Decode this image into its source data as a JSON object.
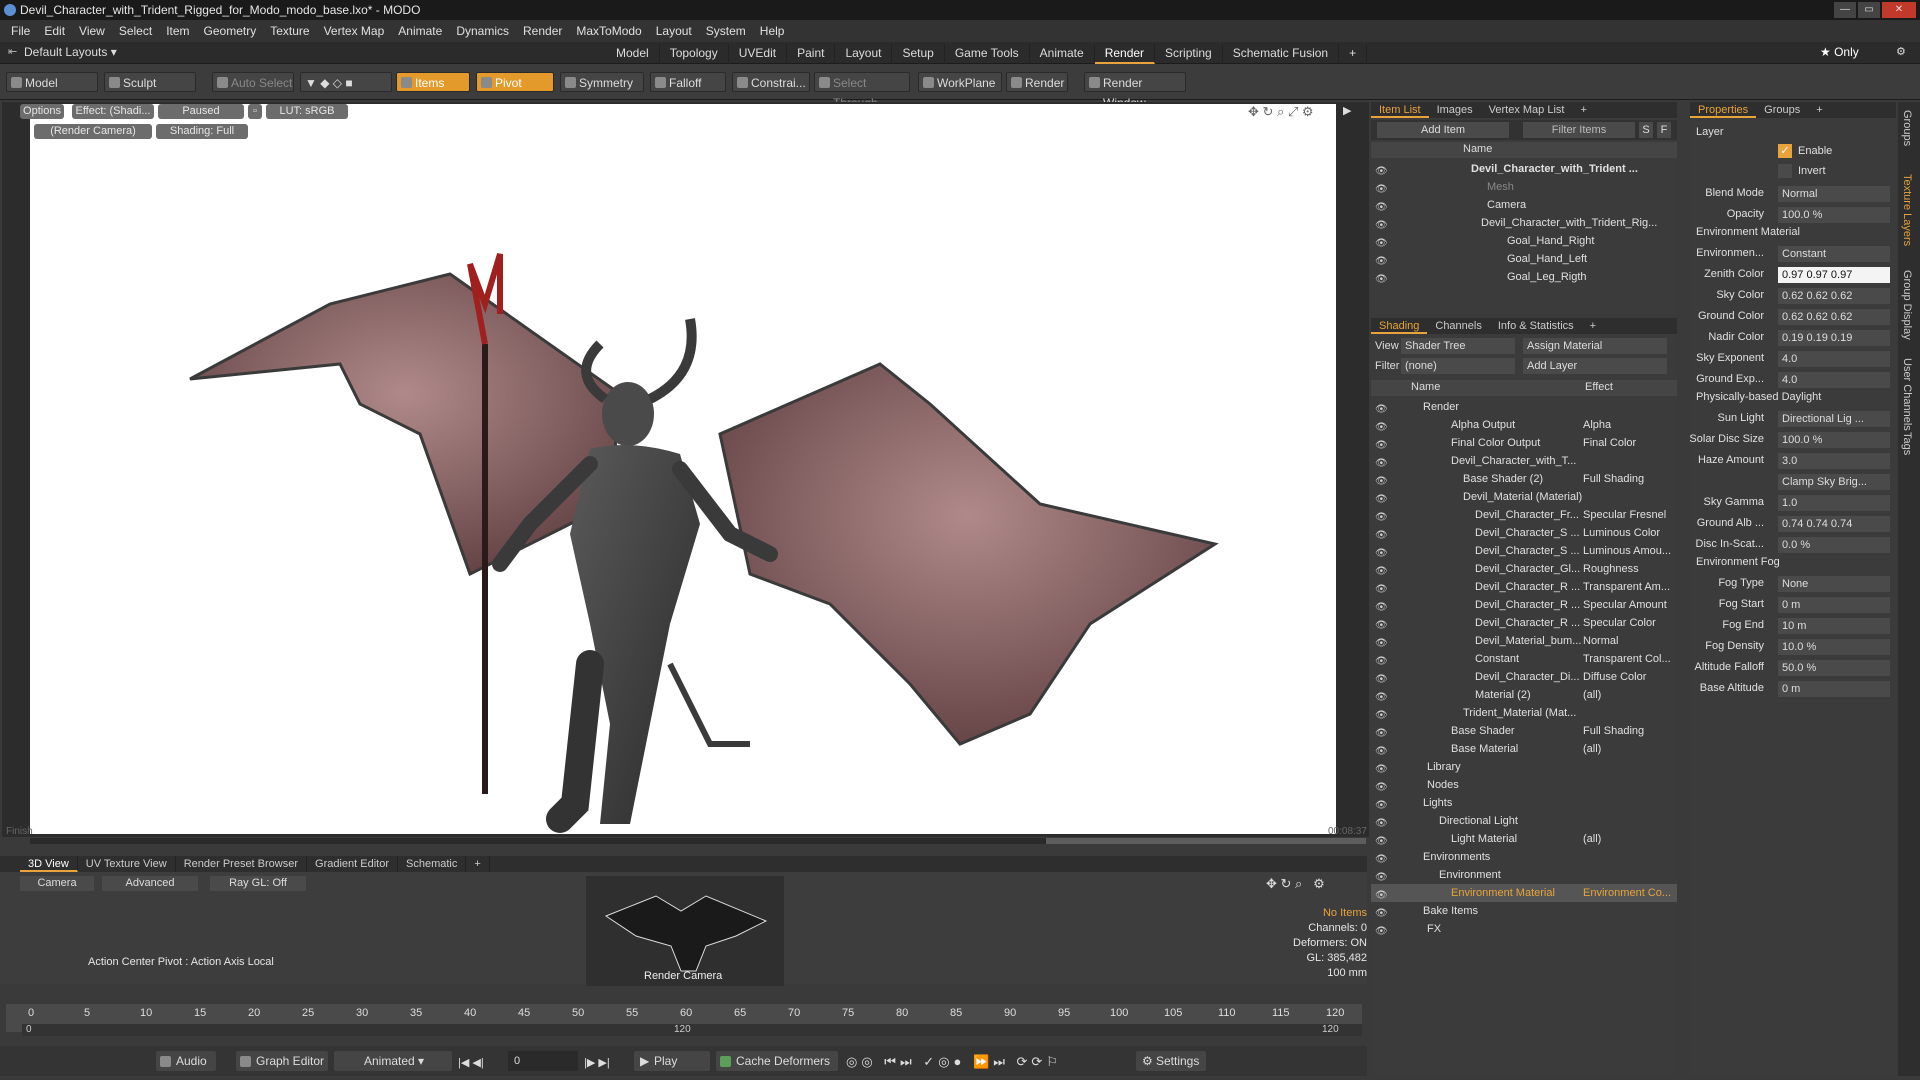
{
  "window": {
    "title": "Devil_Character_with_Trident_Rigged_for_Modo_modo_base.lxo* - MODO"
  },
  "menu": [
    "File",
    "Edit",
    "View",
    "Select",
    "Item",
    "Geometry",
    "Texture",
    "Vertex Map",
    "Animate",
    "Dynamics",
    "Render",
    "MaxToModo",
    "Layout",
    "System",
    "Help"
  ],
  "layout_bar": {
    "layout": "Default Layouts ▾",
    "tabs": [
      "Model",
      "Topology",
      "UVEdit",
      "Paint",
      "Layout",
      "Setup",
      "Game Tools",
      "Animate",
      "Render",
      "Scripting",
      "Schematic Fusion",
      "+"
    ],
    "active": "Render",
    "only": "★ Only"
  },
  "toolbar": {
    "model": "Model",
    "sculpt": "Sculpt",
    "auto_select": "Auto Select",
    "items": "Items",
    "pivot": "Pivot",
    "symmetry": "Symmetry",
    "falloff": "Falloff",
    "constraint": "Constrai...",
    "select_through": "Select Through",
    "workplane": "WorkPlane",
    "render": "Render",
    "render_window": "Render Window"
  },
  "viewport": {
    "options": "Options",
    "effect": "Effect: (Shadi...",
    "paused": "Paused",
    "lut": "LUT: sRGB",
    "camera": "(Render Camera)",
    "shading": "Shading: Full",
    "corner_left": "Finish",
    "corner_right": "00:08:37"
  },
  "bottom": {
    "tabs": [
      "3D View",
      "UV Texture View",
      "Render Preset Browser",
      "Gradient Editor",
      "Schematic",
      "+"
    ],
    "active": "3D View",
    "camera_btn": "Camera",
    "advanced_btn": "Advanced",
    "raygl_btn": "Ray GL: Off",
    "action_center": "Action Center Pivot : Action Axis Local",
    "thumb_label": "Render Camera",
    "status": {
      "no_items": "No Items",
      "channels": "Channels: 0",
      "deformers": "Deformers: ON",
      "gl": "GL: 385,482",
      "size": "100 mm"
    }
  },
  "timeline": {
    "ticks": [
      "0",
      "5",
      "10",
      "15",
      "20",
      "25",
      "30",
      "35",
      "40",
      "45",
      "50",
      "55",
      "60",
      "65",
      "70",
      "75",
      "80",
      "85",
      "90",
      "95",
      "100",
      "105",
      "110",
      "115",
      "120"
    ],
    "sub_start": "0",
    "sub_mid": "120",
    "sub_end": "120"
  },
  "transport": {
    "audio": "Audio",
    "graph_editor": "Graph Editor",
    "animated": "Animated",
    "frame": "0",
    "play": "Play",
    "cache": "Cache Deformers",
    "settings": "Settings"
  },
  "item_list": {
    "tabs": [
      "Item List",
      "Images",
      "Vertex Map List",
      "+"
    ],
    "add_item": "Add Item",
    "filter": "Filter Items",
    "s": "S",
    "f": "F",
    "col_name": "Name",
    "rows": [
      {
        "name": "Devil_Character_with_Trident ...",
        "indent": 100
      },
      {
        "name": "Mesh",
        "indent": 116,
        "dim": true
      },
      {
        "name": "Camera",
        "indent": 116
      },
      {
        "name": "Devil_Character_with_Trident_Rig...",
        "indent": 110
      },
      {
        "name": "Goal_Hand_Right",
        "indent": 136
      },
      {
        "name": "Goal_Hand_Left",
        "indent": 136
      },
      {
        "name": "Goal_Leg_Rigth",
        "indent": 136
      }
    ]
  },
  "shading": {
    "tabs": [
      "Shading",
      "Channels",
      "Info & Statistics",
      "+"
    ],
    "view_label": "View",
    "view_value": "Shader Tree",
    "assign": "Assign Material",
    "filter_label": "Filter",
    "filter_value": "(none)",
    "add_layer": "Add Layer",
    "col_name": "Name",
    "col_effect": "Effect",
    "rows": [
      {
        "name": "Render",
        "effect": "",
        "indent": 52
      },
      {
        "name": "Alpha Output",
        "effect": "Alpha",
        "indent": 80
      },
      {
        "name": "Final Color Output",
        "effect": "Final Color",
        "indent": 80
      },
      {
        "name": "Devil_Character_with_T...",
        "effect": "",
        "indent": 80
      },
      {
        "name": "Base Shader (2)",
        "effect": "Full Shading",
        "indent": 92
      },
      {
        "name": "Devil_Material (Material)",
        "effect": "",
        "indent": 92
      },
      {
        "name": "Devil_Character_Fr...",
        "effect": "Specular Fresnel",
        "indent": 104
      },
      {
        "name": "Devil_Character_S ...",
        "effect": "Luminous Color",
        "indent": 104
      },
      {
        "name": "Devil_Character_S ...",
        "effect": "Luminous Amou...",
        "indent": 104
      },
      {
        "name": "Devil_Character_Gl...",
        "effect": "Roughness",
        "indent": 104
      },
      {
        "name": "Devil_Character_R ...",
        "effect": "Transparent Am...",
        "indent": 104
      },
      {
        "name": "Devil_Character_R ...",
        "effect": "Specular Amount",
        "indent": 104
      },
      {
        "name": "Devil_Character_R ...",
        "effect": "Specular Color",
        "indent": 104
      },
      {
        "name": "Devil_Material_bum...",
        "effect": "Normal",
        "indent": 104
      },
      {
        "name": "Constant",
        "effect": "Transparent Col...",
        "indent": 104
      },
      {
        "name": "Devil_Character_Di...",
        "effect": "Diffuse Color",
        "indent": 104
      },
      {
        "name": "Material (2)",
        "effect": "(all)",
        "indent": 104
      },
      {
        "name": "Trident_Material (Mat...",
        "effect": "",
        "indent": 92
      },
      {
        "name": "Base Shader",
        "effect": "Full Shading",
        "indent": 80
      },
      {
        "name": "Base Material",
        "effect": "(all)",
        "indent": 80
      },
      {
        "name": "Library",
        "effect": "",
        "indent": 56
      },
      {
        "name": "Nodes",
        "effect": "",
        "indent": 56
      },
      {
        "name": "Lights",
        "effect": "",
        "indent": 52
      },
      {
        "name": "Directional Light",
        "effect": "",
        "indent": 68
      },
      {
        "name": "Light Material",
        "effect": "(all)",
        "indent": 80
      },
      {
        "name": "Environments",
        "effect": "",
        "indent": 52
      },
      {
        "name": "Environment",
        "effect": "",
        "indent": 68
      },
      {
        "name": "Environment Material",
        "effect": "Environment Co...",
        "indent": 80,
        "selected": true
      },
      {
        "name": "Bake Items",
        "effect": "",
        "indent": 52
      },
      {
        "name": "FX",
        "effect": "",
        "indent": 56
      }
    ]
  },
  "properties": {
    "tabs": [
      "Properties",
      "Groups",
      "+"
    ],
    "layer": "Layer",
    "enable": "Enable",
    "invert": "Invert",
    "fields": [
      {
        "label": "Blend Mode",
        "value": "Normal"
      },
      {
        "label": "Opacity",
        "value": "100.0 %"
      }
    ],
    "env_material": "Environment Material",
    "env_fields": [
      {
        "label": "Environmen...",
        "value": "Constant"
      },
      {
        "label": "Zenith Color",
        "value": "0.97 0.97 0.97"
      },
      {
        "label": "Sky Color",
        "value": "0.62 0.62 0.62"
      },
      {
        "label": "Ground Color",
        "value": "0.62 0.62 0.62"
      },
      {
        "label": "Nadir Color",
        "value": "0.19 0.19 0.19"
      },
      {
        "label": "Sky Exponent",
        "value": "4.0"
      },
      {
        "label": "Ground Exp...",
        "value": "4.0"
      }
    ],
    "daylight": "Physically-based Daylight",
    "daylight_fields": [
      {
        "label": "Sun Light",
        "value": "Directional Lig ..."
      },
      {
        "label": "Solar Disc Size",
        "value": "100.0 %"
      },
      {
        "label": "Haze Amount",
        "value": "3.0"
      },
      {
        "label": "",
        "value": "Clamp Sky Brig..."
      },
      {
        "label": "Sky Gamma",
        "value": "1.0"
      },
      {
        "label": "Ground Alb ...",
        "value": "0.74 0.74 0.74"
      },
      {
        "label": "Disc In-Scat...",
        "value": "0.0 %"
      }
    ],
    "fog": "Environment Fog",
    "fog_fields": [
      {
        "label": "Fog Type",
        "value": "None"
      },
      {
        "label": "Fog Start",
        "value": "0 m"
      },
      {
        "label": "Fog End",
        "value": "10 m"
      },
      {
        "label": "Fog Density",
        "value": "10.0 %"
      },
      {
        "label": "Altitude Falloff",
        "value": "50.0 %"
      },
      {
        "label": "Base Altitude",
        "value": "0 m"
      }
    ]
  },
  "side_tabs": [
    "Groups",
    "Texture Layers",
    "Group Display",
    "User Channels",
    "Tags"
  ],
  "colors": {
    "accent": "#e8a33a",
    "panel": "#3b3b3b",
    "render_bg": "#ffffff"
  }
}
